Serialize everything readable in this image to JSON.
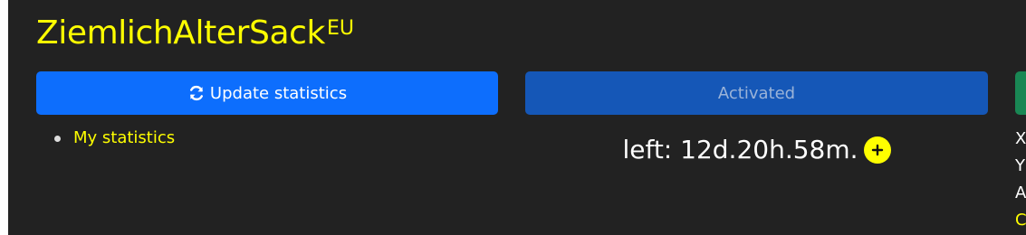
{
  "header": {
    "title": "ZiemlichAlterSack",
    "region": "EU"
  },
  "actions": {
    "update_label": "Update statistics",
    "activated_label": "Activated"
  },
  "nav": {
    "items": [
      {
        "label": "My statistics"
      }
    ]
  },
  "timer": {
    "text": "left: 12d.20h.58m."
  },
  "right_column": {
    "lines": [
      "X",
      "Y",
      "A",
      "C"
    ]
  },
  "colors": {
    "background": "#222222",
    "accent": "#ffff00",
    "primary": "#0d6efd",
    "activated": "#1557b7",
    "success": "#198754"
  },
  "icons": {
    "update": "refresh-icon",
    "timer_add": "plus-icon"
  }
}
